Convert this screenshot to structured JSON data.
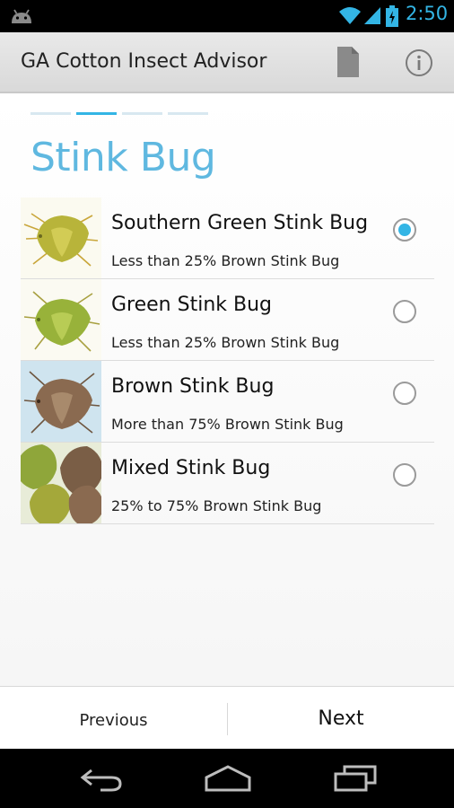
{
  "status_bar": {
    "time": "2:50",
    "icons": [
      "android-icon",
      "wifi-icon",
      "signal-icon",
      "battery-icon"
    ],
    "accent_color": "#33b5e5"
  },
  "action_bar": {
    "title": "GA Cotton Insect Advisor",
    "icons": [
      "document-icon",
      "info-icon"
    ]
  },
  "steps": {
    "total": 4,
    "current": 2,
    "active_color": "#33b5e5",
    "inactive_color": "#d8e8f0"
  },
  "page": {
    "heading": "Stink Bug",
    "heading_color": "#5fb8e0"
  },
  "options": [
    {
      "name": "Southern Green Stink Bug",
      "description": "Less than 25% Brown Stink Bug",
      "selected": true
    },
    {
      "name": "Green Stink Bug",
      "description": "Less than 25% Brown Stink Bug",
      "selected": false
    },
    {
      "name": "Brown Stink Bug",
      "description": "More than 75% Brown Stink Bug",
      "selected": false
    },
    {
      "name": "Mixed Stink Bug",
      "description": "25% to 75% Brown Stink Bug",
      "selected": false
    }
  ],
  "footer": {
    "previous_label": "Previous",
    "next_label": "Next"
  },
  "nav_bar": {
    "icons": [
      "back-icon",
      "home-icon",
      "recent-apps-icon"
    ]
  }
}
